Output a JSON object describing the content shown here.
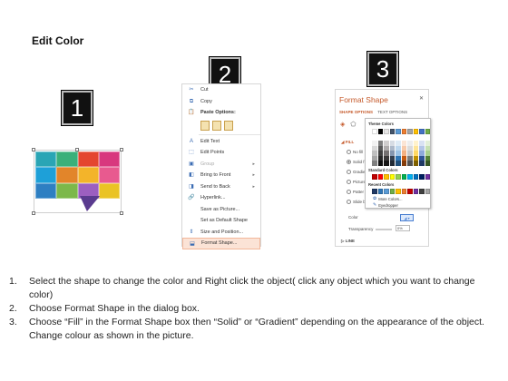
{
  "title": "Edit Color",
  "badges": [
    "1",
    "2",
    "3"
  ],
  "puzzle": {
    "colors": [
      [
        "#2aa5b5",
        "#3bb07a",
        "#e4462f",
        "#d8387e"
      ],
      [
        "#1ea0d8",
        "#e2852a",
        "#f3b42a",
        "#e85a8f"
      ],
      [
        "#2e7fc2",
        "#7cb84a",
        "#9c5fc0",
        "#eac324"
      ]
    ],
    "tail_color": "#5a3b8f"
  },
  "context_menu": {
    "items": [
      {
        "icon": "cut-icon",
        "glyph": "✂",
        "label": "Cut",
        "disabled": false,
        "submenu": false
      },
      {
        "icon": "copy-icon",
        "glyph": "⧉",
        "label": "Copy",
        "disabled": false,
        "submenu": false
      },
      {
        "icon": "paste-icon",
        "glyph": "📋",
        "label": "Paste Options:",
        "disabled": false,
        "submenu": false,
        "bold": true
      }
    ],
    "items2": [
      {
        "icon": "edit-text-icon",
        "glyph": "A",
        "label": "Edit Text",
        "disabled": false,
        "submenu": false
      },
      {
        "icon": "edit-points-icon",
        "glyph": "⬚",
        "label": "Edit Points",
        "disabled": false,
        "submenu": false
      },
      {
        "icon": "group-icon",
        "glyph": "▣",
        "label": "Group",
        "disabled": true,
        "submenu": true
      },
      {
        "icon": "bring-front-icon",
        "glyph": "◧",
        "label": "Bring to Front",
        "disabled": false,
        "submenu": true
      },
      {
        "icon": "send-back-icon",
        "glyph": "◨",
        "label": "Send to Back",
        "disabled": false,
        "submenu": true
      },
      {
        "icon": "hyperlink-icon",
        "glyph": "🔗",
        "label": "Hyperlink...",
        "disabled": false,
        "submenu": false
      },
      {
        "icon": "save-picture-icon",
        "glyph": "",
        "label": "Save as Picture...",
        "disabled": false,
        "submenu": false
      },
      {
        "icon": "default-shape-icon",
        "glyph": "",
        "label": "Set as Default Shape",
        "disabled": false,
        "submenu": false
      },
      {
        "icon": "size-position-icon",
        "glyph": "⇕",
        "label": "Size and Position...",
        "disabled": false,
        "submenu": false
      },
      {
        "icon": "format-shape-icon",
        "glyph": "⬓",
        "label": "Format Shape...",
        "disabled": false,
        "submenu": false,
        "highlight": true
      }
    ]
  },
  "format_pane": {
    "title": "Format Shape",
    "close": "✕",
    "tab_active": "SHAPE OPTIONS",
    "tab_other": "TEXT OPTIONS",
    "fill_header": "◢ FILL",
    "options": [
      "No fill",
      "Solid f",
      "Gradie",
      "Picture",
      "Patter",
      "Slide b"
    ],
    "color_label": "Color",
    "transparency_label": "Transparency",
    "transparency_value": "0%",
    "line_header": "▷ LINE"
  },
  "palette": {
    "theme_header": "Theme Colors",
    "theme_top": [
      "#ffffff",
      "#000000",
      "#e7e6e6",
      "#44546a",
      "#5b9bd5",
      "#ed7d31",
      "#a5a5a5",
      "#ffc000",
      "#4472c4",
      "#70ad47"
    ],
    "theme_cols": [
      [
        "#f2f2f2",
        "#d9d9d9",
        "#bfbfbf",
        "#a6a6a6",
        "#7f7f7f"
      ],
      [
        "#7f7f7f",
        "#595959",
        "#404040",
        "#262626",
        "#0d0d0d"
      ],
      [
        "#d0cece",
        "#aeabab",
        "#757171",
        "#3a3838",
        "#171616"
      ],
      [
        "#d6dce4",
        "#adb9ca",
        "#8496b0",
        "#333f4f",
        "#222a35"
      ],
      [
        "#deebf6",
        "#bdd7ee",
        "#9dc3e6",
        "#2e75b5",
        "#1f4e79"
      ],
      [
        "#fbe5d5",
        "#f7cbac",
        "#f4b183",
        "#c55a11",
        "#833c0b"
      ],
      [
        "#ededed",
        "#dbdbdb",
        "#c9c9c9",
        "#7b7b7b",
        "#525252"
      ],
      [
        "#fff2cc",
        "#fee599",
        "#ffd965",
        "#bf9000",
        "#7f6000"
      ],
      [
        "#d9e2f3",
        "#b4c6e7",
        "#8eaadb",
        "#2f5496",
        "#1f3864"
      ],
      [
        "#e2efd9",
        "#c5e0b3",
        "#a8d08d",
        "#538135",
        "#375623"
      ]
    ],
    "standard_header": "Standard Colors",
    "standard": [
      "#c00000",
      "#ff0000",
      "#ffc000",
      "#ffff00",
      "#92d050",
      "#00b050",
      "#00b0f0",
      "#0070c0",
      "#002060",
      "#7030a0"
    ],
    "recent_header": "Recent Colors",
    "recent": [
      "#1f3864",
      "#2e75b5",
      "#5b9bd5",
      "#70ad47",
      "#ffc000",
      "#ed7d31",
      "#c00000",
      "#7030a0",
      "#404040",
      "#a5a5a5"
    ],
    "more_colors": "More Colors...",
    "eyedropper": "Eyedropper"
  },
  "steps": [
    {
      "n": "1.",
      "text": "Select the shape to change the color and Right click the object( click any object which you want to change color)"
    },
    {
      "n": "2.",
      "text": "Choose Format Shape in the dialog box."
    },
    {
      "n": "3.",
      "text": "Choose “Fill” in the Format Shape box then “Solid” or “Gradient” depending on the appearance of the object. Change colour as shown in the picture."
    }
  ]
}
